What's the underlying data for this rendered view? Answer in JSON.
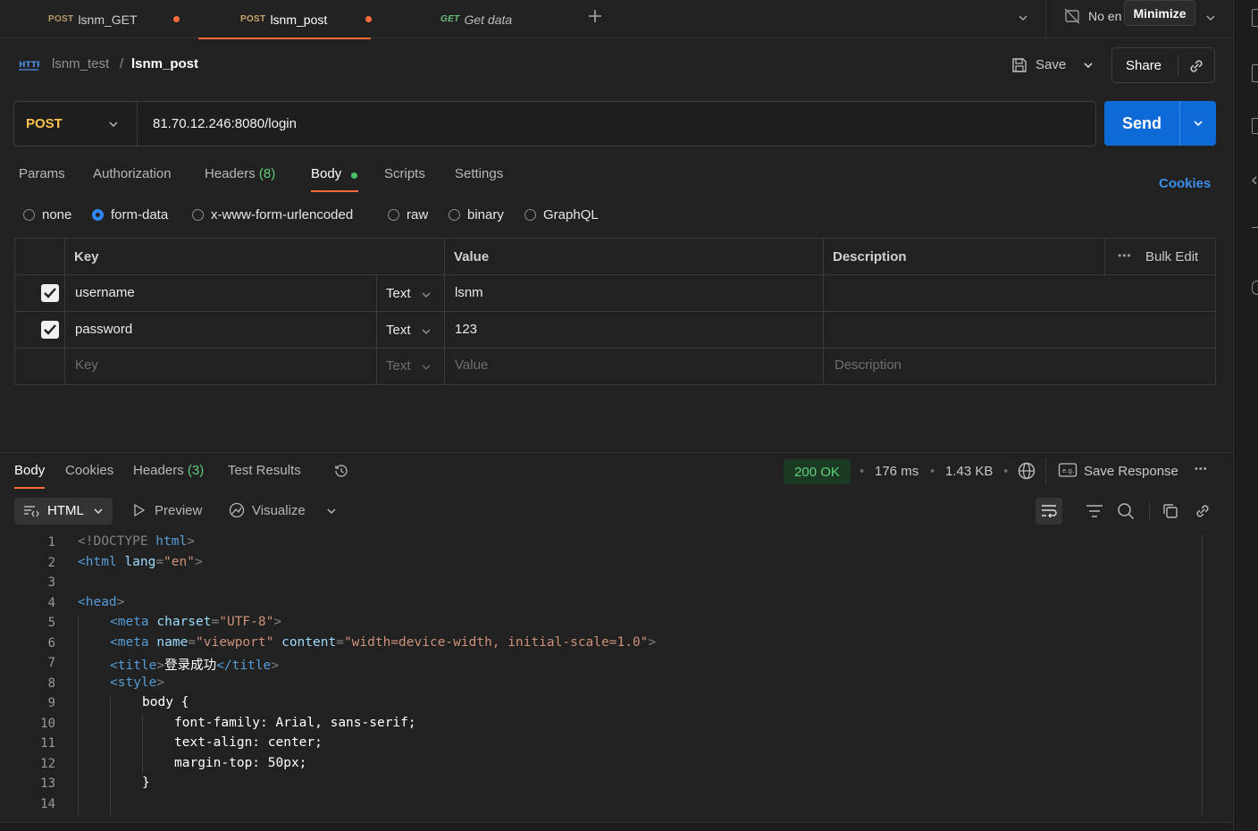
{
  "tabs": [
    {
      "method": "POST",
      "name": "lsnm_GET",
      "unsaved": true
    },
    {
      "method": "POST",
      "name": "lsnm_post",
      "unsaved": true,
      "active": true
    },
    {
      "method": "GET",
      "name": "Get data"
    }
  ],
  "env_label": "No en",
  "minimize_tooltip": "Minimize",
  "breadcrumb": {
    "collection": "lsnm_test",
    "separator": "/",
    "request": "lsnm_post"
  },
  "actions": {
    "save": "Save",
    "share": "Share"
  },
  "request": {
    "method": "POST",
    "url": "81.70.12.246:8080/login",
    "send": "Send"
  },
  "request_tabs": {
    "params": "Params",
    "authorization": "Authorization",
    "headers": "Headers",
    "headers_count": "(8)",
    "body": "Body",
    "scripts": "Scripts",
    "settings": "Settings",
    "cookies": "Cookies"
  },
  "body_types": [
    "none",
    "form-data",
    "x-www-form-urlencoded",
    "raw",
    "binary",
    "GraphQL"
  ],
  "body_type_selected": "form-data",
  "form_table": {
    "headers": {
      "key": "Key",
      "value": "Value",
      "description": "Description",
      "bulk_edit": "Bulk Edit"
    },
    "rows": [
      {
        "checked": true,
        "key": "username",
        "type": "Text",
        "value": "lsnm",
        "description": ""
      },
      {
        "checked": true,
        "key": "password",
        "type": "Text",
        "value": "123",
        "description": ""
      }
    ],
    "placeholder": {
      "key": "Key",
      "type": "Text",
      "value": "Value",
      "description": "Description"
    }
  },
  "response": {
    "tabs": {
      "body": "Body",
      "cookies": "Cookies",
      "headers": "Headers",
      "headers_count": "(3)",
      "test_results": "Test Results"
    },
    "status": "200 OK",
    "time": "176 ms",
    "size": "1.43 KB",
    "save_response": "Save Response",
    "format": "HTML",
    "preview": "Preview",
    "visualize": "Visualize"
  },
  "code_line_numbers": [
    "1",
    "2",
    "3",
    "4",
    "5",
    "6",
    "7",
    "8",
    "9",
    "10",
    "11",
    "12",
    "13",
    "14"
  ],
  "code": {
    "l1": {
      "open": "<!DOCTYPE",
      "tag": " html",
      "close": ">"
    },
    "l2": {
      "open": "<html",
      "attr": " lang",
      "eq": "=",
      "val": "\"en\"",
      "close": ">"
    },
    "l4": {
      "open": "<head",
      "close": ">"
    },
    "l5": {
      "open": "<meta",
      "attr": " charset",
      "eq": "=",
      "val": "\"UTF-8\"",
      "close": ">"
    },
    "l6": {
      "open": "<meta",
      "attr1": " name",
      "eq1": "=",
      "val1": "\"viewport\"",
      "attr2": " content",
      "eq2": "=",
      "val2": "\"width=device-width, initial-scale=1.0\"",
      "close": ">"
    },
    "l7": {
      "open": "<title",
      "close": ">",
      "text": "登录成功",
      "end_open": "</title",
      "end_close": ">"
    },
    "l8": {
      "open": "<style",
      "close": ">"
    },
    "l9": "body {",
    "l10": "font-family: Arial, sans-serif;",
    "l11": "text-align: center;",
    "l12": "margin-top: 50px;",
    "l13": "}"
  }
}
